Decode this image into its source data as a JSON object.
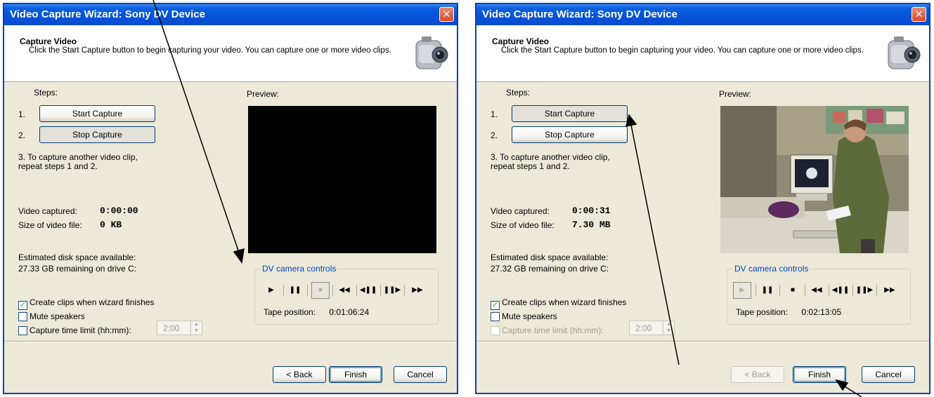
{
  "left": {
    "title": "Video Capture Wizard: Sony DV Device",
    "close_label": "✕",
    "header_title": "Capture Video",
    "header_desc": "Click the Start Capture button to begin capturing your video. You can capture one or more video clips.",
    "steps_label": "Steps:",
    "step1_num": "1.",
    "step2_num": "2.",
    "start_capture": "Start Capture",
    "stop_capture": "Stop Capture",
    "step3_text": "3.  To capture another video clip, repeat steps 1 and 2.",
    "video_captured_label": "Video captured:",
    "video_captured_value": "0:00:00",
    "file_size_label": "Size of video file:",
    "file_size_value": "0 KB",
    "disk_label": "Estimated disk space available:",
    "disk_value": "27.33 GB remaining on drive C:",
    "preview_label": "Preview:",
    "dv_title": "DV camera controls",
    "tape_label": "Tape position:",
    "tape_value": "0:01:06:24",
    "chk_create": "Create clips when wizard finishes",
    "chk_mute": "Mute speakers",
    "chk_limit": "Capture time limit (hh:mm):",
    "limit_value": "2:00",
    "back": "< Back",
    "finish": "Finish",
    "cancel": "Cancel"
  },
  "right": {
    "title": "Video Capture Wizard: Sony DV Device",
    "close_label": "✕",
    "header_title": "Capture Video",
    "header_desc": "Click the Start Capture button to begin capturing your video. You can capture one or more video clips.",
    "steps_label": "Steps:",
    "step1_num": "1.",
    "step2_num": "2.",
    "start_capture": "Start Capture",
    "stop_capture": "Stop Capture",
    "step3_text": "3.  To capture another video clip, repeat steps 1 and 2.",
    "video_captured_label": "Video captured:",
    "video_captured_value": "0:00:31",
    "file_size_label": "Size of video file:",
    "file_size_value": "7.30 MB",
    "disk_label": "Estimated disk space available:",
    "disk_value": "27.32 GB remaining on drive C:",
    "preview_label": "Preview:",
    "dv_title": "DV camera controls",
    "tape_label": "Tape position:",
    "tape_value": "0:02:13:05",
    "chk_create": "Create clips when wizard finishes",
    "chk_mute": "Mute speakers",
    "chk_limit": "Capture time limit (hh:mm):",
    "limit_value": "2:00",
    "back": "< Back",
    "finish": "Finish",
    "cancel": "Cancel"
  },
  "dv_controls": {
    "play": "▶",
    "pause": "❚❚",
    "stop": "■",
    "rewind": "◀◀",
    "step_back": "◀❚❚",
    "step_forward": "❚❚▶",
    "fast_forward": "▶▶"
  },
  "checkmark": "✓",
  "colors": {
    "titlebar": "#0453d6",
    "window_bg": "#ece9d8",
    "group_title": "#0046d5"
  }
}
